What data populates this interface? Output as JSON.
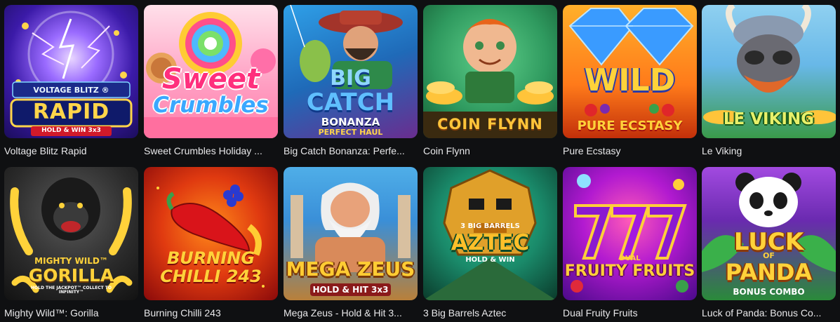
{
  "games": [
    {
      "title": "Voltage Blitz Rapid",
      "logo_lines": [
        "VOLTAGE BLITZ ®",
        "RAPID",
        "HOLD & WIN 3x3"
      ],
      "colors": {
        "bg1": "#2b1d8f",
        "bg2": "#8a2be2",
        "accent": "#ffd54a"
      }
    },
    {
      "title": "Sweet Crumbles Holiday ...",
      "logo_lines": [
        "Sweet",
        "Crumbles"
      ],
      "colors": {
        "bg1": "#ff8fb8",
        "bg2": "#ffe3ee",
        "accent": "#ff2f7d"
      }
    },
    {
      "title": "Big Catch Bonanza: Perfe...",
      "logo_lines": [
        "BIG",
        "CATCH",
        "BONANZA",
        "PERFECT HAUL"
      ],
      "colors": {
        "bg1": "#1f7cc9",
        "bg2": "#7a2d8f",
        "accent": "#4fb5ff"
      }
    },
    {
      "title": "Coin Flynn",
      "logo_lines": [
        "COIN FLYNN"
      ],
      "colors": {
        "bg1": "#2f9a5f",
        "bg2": "#0f4a2f",
        "accent": "#ffc43a"
      }
    },
    {
      "title": "Pure Ecstasy",
      "logo_lines": [
        "WILD",
        "PURE ECSTASY"
      ],
      "colors": {
        "bg1": "#ff9a1a",
        "bg2": "#e04a10",
        "accent": "#2f7bff"
      }
    },
    {
      "title": "Le Viking",
      "logo_lines": [
        "LE VIKING"
      ],
      "colors": {
        "bg1": "#68b8e8",
        "bg2": "#2f8a3a",
        "accent": "#e08a3a"
      }
    },
    {
      "title": "Mighty Wild™: Gorilla",
      "logo_lines": [
        "MIGHTY WILD™",
        "GORILLA",
        "HOLD THE JACKPOT™ COLLECT TO INFINITY™"
      ],
      "colors": {
        "bg1": "#2a2a2a",
        "bg2": "#5a4a1a",
        "accent": "#ffd23a"
      }
    },
    {
      "title": "Burning Chilli 243",
      "logo_lines": [
        "BURNING",
        "CHILLI 243"
      ],
      "colors": {
        "bg1": "#b3140f",
        "bg2": "#ff6a1a",
        "accent": "#ffd54a"
      }
    },
    {
      "title": "Mega Zeus - Hold & Hit 3...",
      "logo_lines": [
        "MEGA ZEUS",
        "HOLD & HIT 3x3"
      ],
      "colors": {
        "bg1": "#3a8fd8",
        "bg2": "#c98a3a",
        "accent": "#ffcc33"
      }
    },
    {
      "title": "3 Big Barrels Aztec",
      "logo_lines": [
        "3 BIG BARRELS",
        "AZTEC",
        "HOLD & WIN"
      ],
      "colors": {
        "bg1": "#1a8a6a",
        "bg2": "#0e4a3a",
        "accent": "#ffbf2a"
      }
    },
    {
      "title": "Dual Fruity Fruits",
      "logo_lines": [
        "DUAL",
        "FRUITY FRUITS"
      ],
      "colors": {
        "bg1": "#6a12b8",
        "bg2": "#ff3aa0",
        "accent": "#ffcf3a"
      }
    },
    {
      "title": "Luck of Panda: Bonus Co...",
      "logo_lines": [
        "LUCK",
        "OF",
        "PANDA",
        "BONUS COMBO"
      ],
      "colors": {
        "bg1": "#8a3ad0",
        "bg2": "#2a9a4a",
        "accent": "#ffd23a"
      }
    }
  ]
}
